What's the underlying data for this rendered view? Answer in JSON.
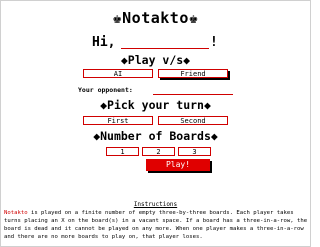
{
  "title": "♚Notakto♚",
  "greeting": {
    "hi": "Hi,",
    "exclaim": "!"
  },
  "play_vs": {
    "heading": "◆Play v/s◆",
    "options": [
      "AI",
      "Friend"
    ],
    "selected": "Friend"
  },
  "opponent": {
    "label": "Your opponent:"
  },
  "turn": {
    "heading": "◆Pick your turn◆",
    "options": [
      "First",
      "Second"
    ]
  },
  "boards": {
    "heading": "◆Number of Boards◆",
    "options": [
      "1",
      "2",
      "3"
    ]
  },
  "play_button": "Play!",
  "instructions": {
    "title": "Instructions",
    "keyword": "Notakto",
    "text": " is played on a finite number of empty three-by-three boards. Each player takes turns placing an X on the board(s) in a vacant space. If a board has a three-in-a-row, the board is dead and it cannot be played on any more. When one player makes a three-in-a-row and there are no more boards to play on, that player loses."
  },
  "colors": {
    "accent": "#d00000",
    "play_button": "#e00000"
  }
}
